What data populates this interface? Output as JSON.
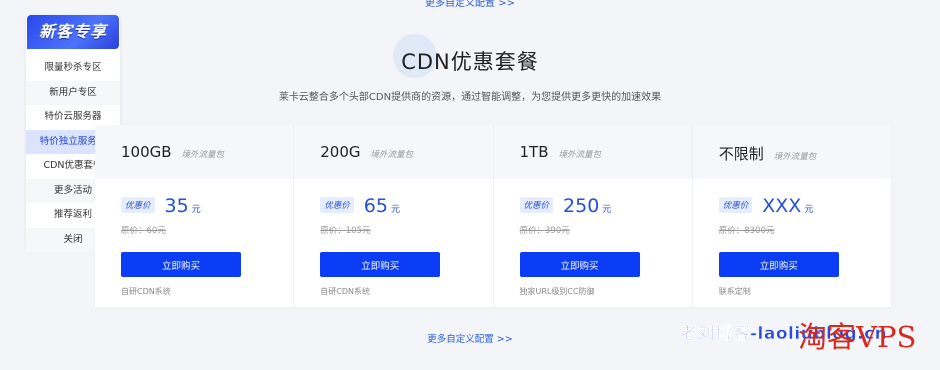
{
  "top_link": "更多自定义配置 >>",
  "heading": {
    "title": "CDN优惠套餐",
    "subtitle": "莱卡云整合多个头部CDN提供商的资源，通过智能调整，为您提供更多更快的加速效果"
  },
  "promo": {
    "title": "新客专享",
    "items": [
      {
        "label": "限量秒杀专区"
      },
      {
        "label": "新用户专区"
      },
      {
        "label": "特价云服务器"
      },
      {
        "label": "特价独立服务器"
      },
      {
        "label": "CDN优惠套餐"
      },
      {
        "label": "更多活动"
      },
      {
        "label": "推荐返利"
      },
      {
        "label": "关闭"
      }
    ],
    "active_index": 3
  },
  "plans": [
    {
      "name": "100GB",
      "tag": "境外流量包",
      "badge": "优惠价",
      "price": "35",
      "unit": "元",
      "original": "原价：60元",
      "button": "立即购买",
      "note": "自研CDN系统"
    },
    {
      "name": "200G",
      "tag": "境外流量包",
      "badge": "优惠价",
      "price": "65",
      "unit": "元",
      "original": "原价：105元",
      "button": "立即购买",
      "note": "自研CDN系统"
    },
    {
      "name": "1TB",
      "tag": "境外流量包",
      "badge": "优惠价",
      "price": "250",
      "unit": "元",
      "original": "原价：390元",
      "button": "立即购买",
      "note": "独家URL级别CC防御"
    },
    {
      "name": "不限制",
      "tag": "境外流量包",
      "badge": "优惠价",
      "price": "XXX",
      "unit": "元",
      "original": "原价：8300元",
      "button": "立即购买",
      "note": "联系定制"
    }
  ],
  "more_link": "更多自定义配置 >>",
  "watermark": {
    "blog": "老刘博客-laoliublog.cn",
    "vps": "淘客VPS"
  },
  "colors": {
    "accent": "#0a3df5",
    "price": "#2451d6",
    "background": "#f3f5f9",
    "watermark_red": "#d9281e"
  }
}
